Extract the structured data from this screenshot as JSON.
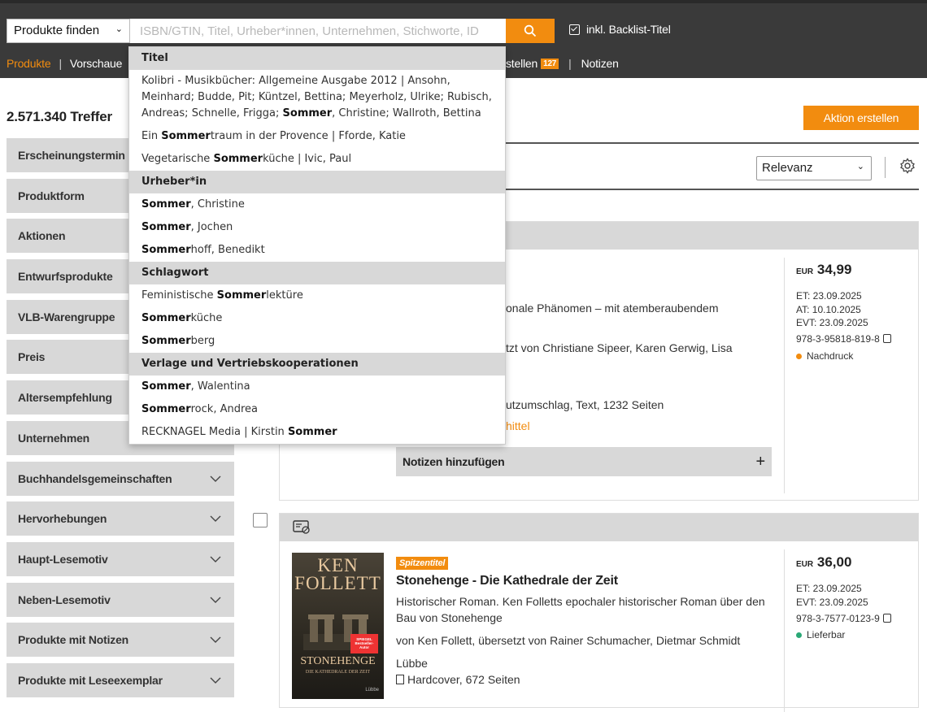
{
  "header": {
    "search_type": "Produkte finden",
    "search_placeholder": "ISBN/GTIN, Titel, Urheber*innen, Unternehmen, Stichworte, ID",
    "backlist_label": "inkl. Backlist-Titel"
  },
  "nav": {
    "active": "Produkte",
    "second": "Vorschaue",
    "right_text": "stellen",
    "badge": "127",
    "notes": "Notizen"
  },
  "results": {
    "count": "2.571.340 Treffer",
    "action_button": "Aktion erstellen",
    "sort": "Relevanz"
  },
  "filters": [
    "Erscheinungstermin",
    "Produktform",
    "Aktionen",
    "Entwurfsprodukte",
    "VLB-Warengruppe",
    "Preis",
    "Altersempfehlung",
    "Unternehmen",
    "Buchhandelsgemeinschaften",
    "Hervorhebungen",
    "Haupt-Lesemotiv",
    "Neben-Lesemotiv",
    "Produkte mit Notizen",
    "Produkte mit Leseexemplar"
  ],
  "dropdown": {
    "sections": [
      {
        "title": "Titel",
        "items": [
          {
            "parts": [
              [
                "Kolibri - Musikbücher: Allgemeine Ausgabe 2012 | Ansohn, Meinhard; Budde, Pit; Küntzel, Bettina; Meyerholz, Ulrike; Rubisch, Andreas; Schnelle, Frigga; ",
                false
              ],
              [
                "Sommer",
                true
              ],
              [
                ", Christine; Wallroth, Bettina",
                false
              ]
            ]
          },
          {
            "parts": [
              [
                "Ein ",
                false
              ],
              [
                "Sommer",
                true
              ],
              [
                "traum in der Provence | Fforde, Katie",
                false
              ]
            ]
          },
          {
            "parts": [
              [
                "Vegetarische ",
                false
              ],
              [
                "Sommer",
                true
              ],
              [
                "küche | Ivic, Paul",
                false
              ]
            ]
          }
        ]
      },
      {
        "title": "Urheber*in",
        "items": [
          {
            "parts": [
              [
                "Sommer",
                true
              ],
              [
                ", Christine",
                false
              ]
            ]
          },
          {
            "parts": [
              [
                "Sommer",
                true
              ],
              [
                ", Jochen",
                false
              ]
            ]
          },
          {
            "parts": [
              [
                "Sommer",
                true
              ],
              [
                "hoff, Benedikt",
                false
              ]
            ]
          }
        ]
      },
      {
        "title": "Schlagwort",
        "items": [
          {
            "parts": [
              [
                "Feministische ",
                false
              ],
              [
                "Sommer",
                true
              ],
              [
                "lektüre",
                false
              ]
            ]
          },
          {
            "parts": [
              [
                "Sommer",
                true
              ],
              [
                "küche",
                false
              ]
            ]
          },
          {
            "parts": [
              [
                "Sommer",
                true
              ],
              [
                "berg",
                false
              ]
            ]
          }
        ]
      },
      {
        "title": "Verlage und Vertriebskooperationen",
        "items": [
          {
            "parts": [
              [
                "Sommer",
                true
              ],
              [
                ", Walentina",
                false
              ]
            ]
          },
          {
            "parts": [
              [
                "Sommer",
                true
              ],
              [
                "rock, Andrea",
                false
              ]
            ]
          },
          {
            "parts": [
              [
                "RECKNAGEL Media | Kirstin ",
                false
              ],
              [
                "Sommer",
                true
              ]
            ]
          }
        ]
      }
    ]
  },
  "card1": {
    "currency": "EUR",
    "price": "34,99",
    "et": "ET: 23.09.2025",
    "at": "AT: 10.10.2025",
    "evt": "EVT: 23.09.2025",
    "isbn": "978-3-95818-819-8",
    "status": "Nachdruck",
    "status_color": "#f28c0f",
    "desc_fragment": "onale Phänomen – mit atemberaubendem",
    "translators_fragment": "tzt von Christiane Sipeer, Karen Gerwig, Lisa",
    "format_fragment": "utzumschlag, Text, 1232 Seiten",
    "link_fragment": "hittel",
    "notes_label": "Notizen hinzufügen"
  },
  "card2": {
    "badge": "Spitzentitel",
    "title": "Stonehenge - Die Kathedrale der Zeit",
    "description": "Historischer Roman. Ken Folletts epochaler historischer Roman über den",
    "description2": "Bau von Stonehenge",
    "authors": "von Ken Follett, übersetzt von Rainer Schumacher, Dietmar Schmidt",
    "publisher": "Lübbe",
    "format": "Hardcover, 672 Seiten",
    "currency": "EUR",
    "price": "36,00",
    "et": "ET: 23.09.2025",
    "evt": "EVT: 23.09.2025",
    "isbn": "978-3-7577-0123-9",
    "status": "Lieferbar",
    "status_color": "#2aa876",
    "cover": {
      "author": "KEN FOLLETT",
      "title": "STONEHENGE",
      "subtitle": "DIE KATHEDRALE DER ZEIT",
      "sticker": "SPIEGEL Bestseller-Autor",
      "publisher": "Lübbe"
    }
  },
  "colors": {
    "accent": "#f28c0f",
    "topbar": "#3a3a3a",
    "panel": "#d8d8d8"
  }
}
